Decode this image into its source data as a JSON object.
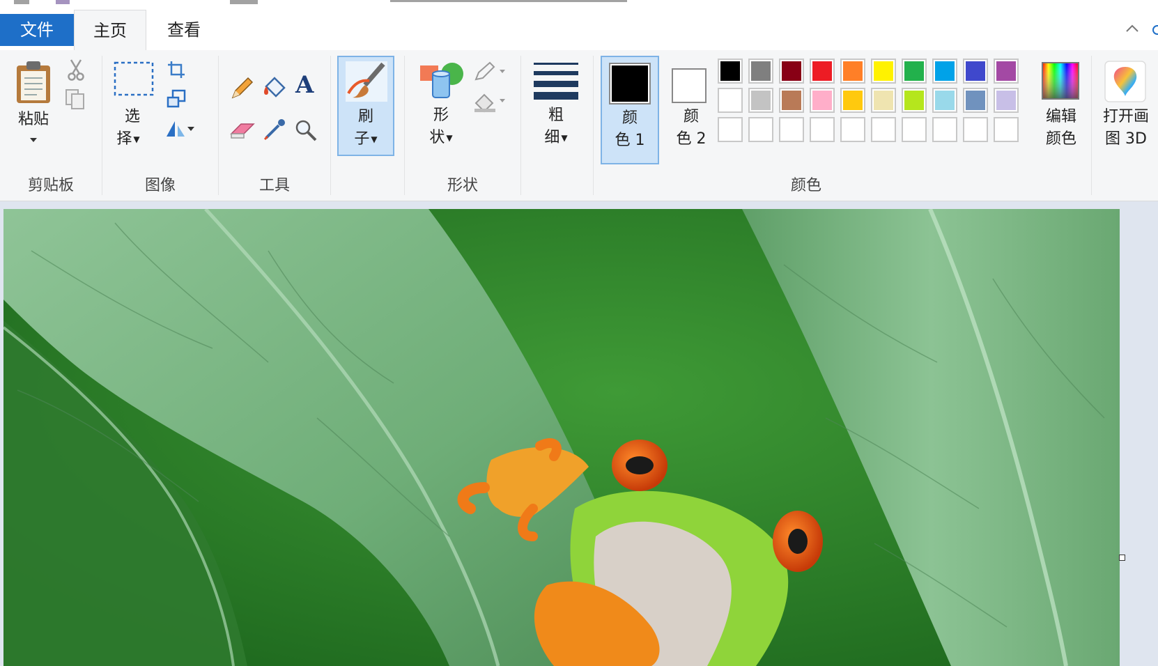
{
  "tabs": {
    "file": "文件",
    "home": "主页",
    "view": "查看"
  },
  "clipboard": {
    "group_label": "剪贴板",
    "paste_label": "粘贴"
  },
  "image": {
    "group_label": "图像",
    "select_line1": "选",
    "select_line2": "择"
  },
  "tools": {
    "group_label": "工具"
  },
  "brush": {
    "line1": "刷",
    "line2": "子"
  },
  "shapes": {
    "group_label": "形状",
    "line1": "形",
    "line2": "状"
  },
  "size": {
    "line1": "粗",
    "line2": "细"
  },
  "colors": {
    "group_label": "颜色",
    "color1_line1": "颜",
    "color1_line2": "色 1",
    "color2_line1": "颜",
    "color2_line2": "色 2",
    "color1_value": "#000000",
    "color2_value": "#ffffff",
    "edit_line1": "编辑",
    "edit_line2": "颜色",
    "paint3d_line1": "打开画",
    "paint3d_line2": "图 3D",
    "palette_row1": [
      "#000000",
      "#7f7f7f",
      "#880015",
      "#ed1c24",
      "#ff7f27",
      "#fff200",
      "#22b14c",
      "#00a2e8",
      "#3f48cc",
      "#a349a4"
    ],
    "palette_row2": [
      "#ffffff",
      "#c3c3c3",
      "#b97a57",
      "#ffaec9",
      "#ffc90e",
      "#efe4b0",
      "#b5e61d",
      "#99d9ea",
      "#7092be",
      "#c8bfe7"
    ],
    "palette_row3": [
      "#ffffff",
      "#ffffff",
      "#ffffff",
      "#ffffff",
      "#ffffff",
      "#ffffff",
      "#ffffff",
      "#ffffff",
      "#ffffff",
      "#ffffff"
    ]
  },
  "icons": {
    "paste": "clipboard-icon",
    "cut": "scissors-icon",
    "copy": "copy-icon",
    "select": "dashed-rectangle-icon",
    "crop": "crop-icon",
    "resize": "resize-icon",
    "rotate": "rotate-icon",
    "pencil": "pencil-icon",
    "fill": "paint-bucket-icon",
    "text": "text-icon",
    "eraser": "eraser-icon",
    "picker": "eyedropper-icon",
    "magnifier": "magnifier-icon",
    "brush": "brush-icon",
    "shapes": "shapes-icon",
    "outline": "outline-icon",
    "shapefill": "shape-fill-icon",
    "size": "line-size-icon",
    "edit_colors": "color-spectrum-icon",
    "paint3d": "paint-3d-icon"
  }
}
